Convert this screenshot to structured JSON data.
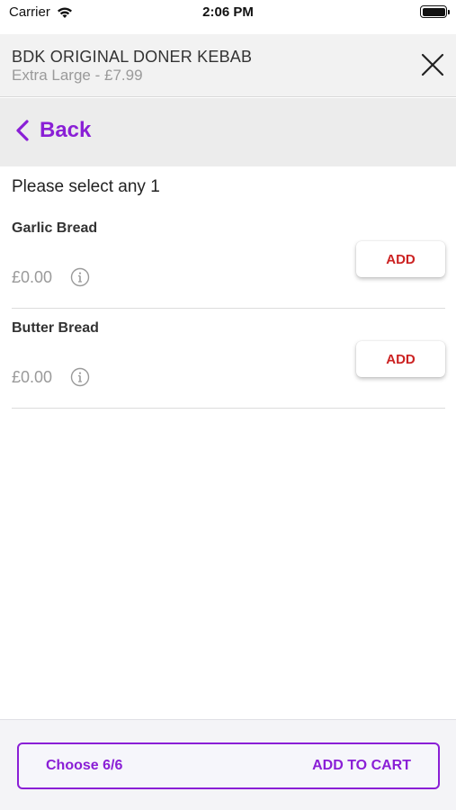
{
  "status_bar": {
    "carrier": "Carrier",
    "time": "2:06 PM"
  },
  "header": {
    "title": "BDK ORIGINAL DONER KEBAB",
    "subtitle": "Extra Large - £7.99",
    "close_icon": "close-icon"
  },
  "nav": {
    "back_label": "Back",
    "back_icon": "chevron-left-icon"
  },
  "content": {
    "instruction": "Please select any 1",
    "options": [
      {
        "name": "Garlic Bread",
        "price": "£0.00",
        "button": "ADD",
        "info_icon": "info-icon"
      },
      {
        "name": "Butter Bread",
        "price": "£0.00",
        "button": "ADD",
        "info_icon": "info-icon"
      }
    ]
  },
  "footer": {
    "choose_label": "Choose 6/6",
    "cart_label": "ADD TO CART"
  },
  "colors": {
    "accent": "#8a1fd6",
    "add_text": "#cc2222",
    "muted": "#9a9a9a"
  }
}
